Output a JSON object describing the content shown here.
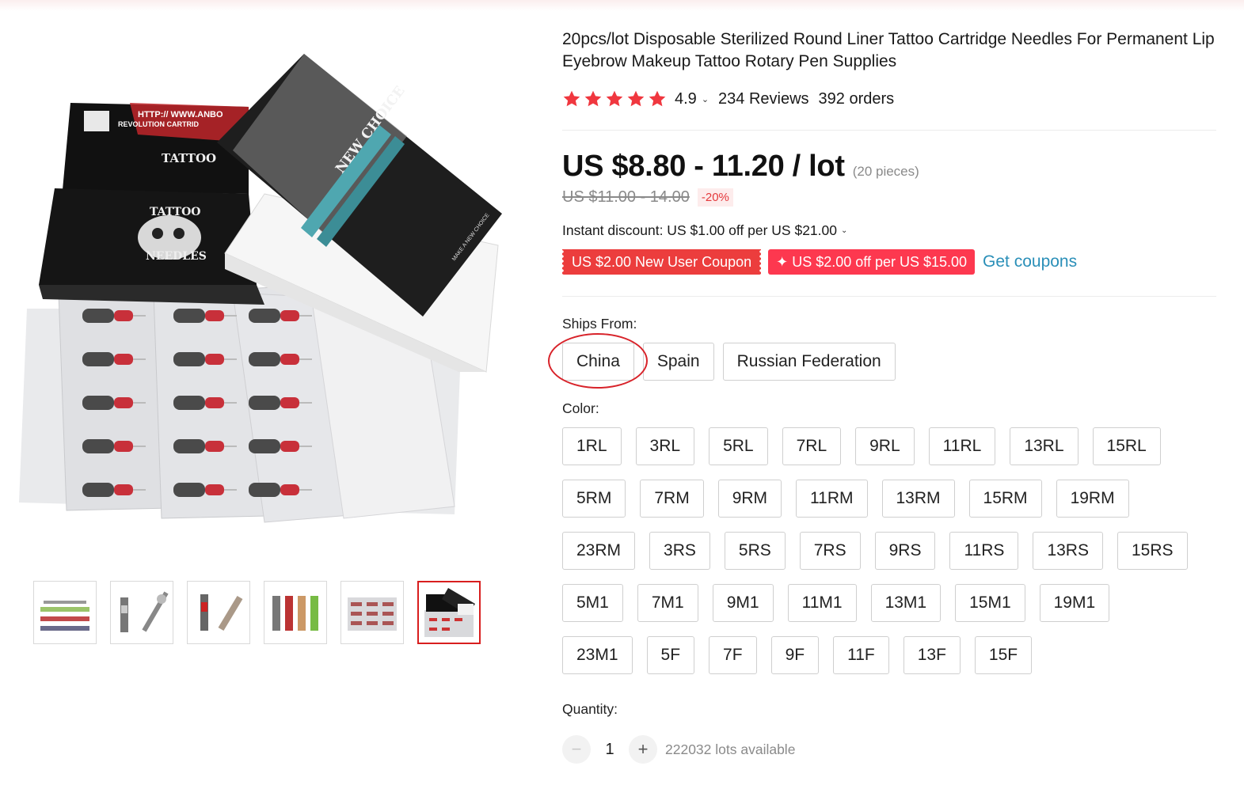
{
  "product": {
    "title": "20pcs/lot Disposable Sterilized Round Liner Tattoo Cartridge Needles For Permanent Lip Eyebrow Makeup Tattoo Rotary Pen Supplies",
    "rating": "4.9",
    "reviews": "234 Reviews",
    "orders": "392 orders"
  },
  "price": {
    "current": "US $8.80 - 11.20 / lot",
    "pieces": "(20 pieces)",
    "original": "US $11.00 - 14.00",
    "discount": "-20%"
  },
  "promotions": {
    "instant_discount": "Instant discount: US $1.00 off per US $21.00",
    "coupon_new_user": "US $2.00 New User Coupon",
    "coupon_store": "✦ US $2.00 off per US $15.00",
    "get_coupons": "Get coupons"
  },
  "ships_from": {
    "label": "Ships From:",
    "options": [
      "China",
      "Spain",
      "Russian Federation"
    ],
    "selected": "China"
  },
  "color": {
    "label": "Color:",
    "rows": [
      [
        "1RL",
        "3RL",
        "5RL",
        "7RL",
        "9RL",
        "11RL",
        "13RL",
        "15RL"
      ],
      [
        "5RM",
        "7RM",
        "9RM",
        "11RM",
        "13RM",
        "15RM",
        "19RM"
      ],
      [
        "23RM",
        "3RS",
        "5RS",
        "7RS",
        "9RS",
        "11RS",
        "13RS",
        "15RS"
      ],
      [
        "5M1",
        "7M1",
        "9M1",
        "11M1",
        "13M1",
        "15M1",
        "19M1"
      ],
      [
        "23M1",
        "5F",
        "7F",
        "9F",
        "11F",
        "13F",
        "15F"
      ]
    ]
  },
  "quantity": {
    "label": "Quantity:",
    "value": "1",
    "minus": "−",
    "plus": "+",
    "available": "222032 lots available"
  },
  "image_text": {
    "box1_url": "HTTP:// WWW.ANBO",
    "box1_sub": "REVOLUTION CARTRID",
    "box1_brand": "TATTOO",
    "box2_brand_top": "TATTOO",
    "box2_brand_bottom": "NEEDLES",
    "box3_brand": "NEW CHOICE",
    "box3_side": "MAKE A NEW CHOICE"
  },
  "thumbnails": [
    "thumb-cartridges-colored",
    "thumb-needle-liner",
    "thumb-needle-magnum",
    "thumb-cartridge-set",
    "thumb-blister-pack",
    "thumb-boxes"
  ],
  "colors": {
    "accent": "#d81e1e",
    "coupon": "#ec3d3d",
    "star": "#f0373f",
    "link": "#2a8fb8"
  }
}
